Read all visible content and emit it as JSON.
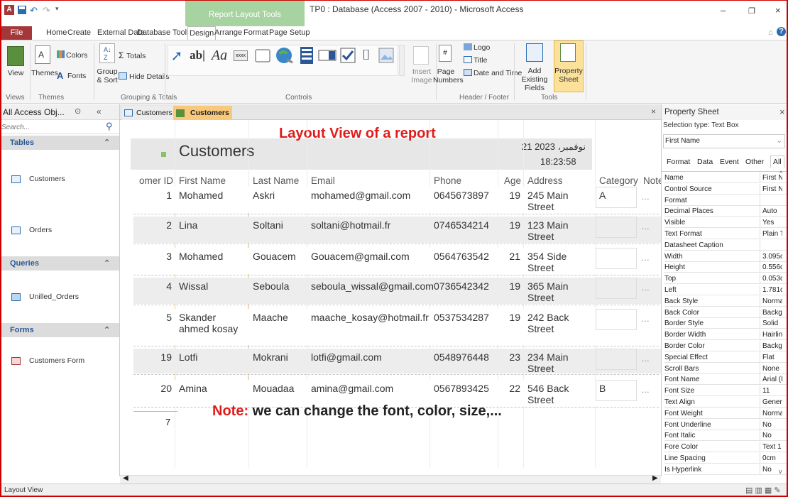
{
  "app": {
    "window_title": "TP0 : Database (Access 2007 - 2010) - Microsoft Access",
    "context_tab": "Report Layout Tools",
    "status_left": "Layout View"
  },
  "ribbon": {
    "tabs": [
      "File",
      "Home",
      "Create",
      "External Data",
      "Database Tools",
      "Design",
      "Arrange",
      "Format",
      "Page Setup"
    ],
    "active_tab": "Design",
    "views": {
      "view_label": "View",
      "group": "Views"
    },
    "themes": {
      "themes_label": "Themes",
      "colors_label": "Colors",
      "fonts_label": "Fonts",
      "group": "Themes"
    },
    "grouping": {
      "group_sort_label": "Group & Sort",
      "totals_label": "Totals",
      "hide_details_label": "Hide Details",
      "group": "Grouping & Totals"
    },
    "controls": {
      "group": "Controls",
      "textbox_glyph": "ab|",
      "label_glyph": "Aa",
      "button_glyph": "xxxx",
      "insert_image_label": "Insert Image"
    },
    "header_footer": {
      "page_numbers_label": "Page Numbers",
      "logo_label": "Logo",
      "title_label": "Title",
      "date_time_label": "Date and Time",
      "group": "Header / Footer"
    },
    "tools": {
      "add_existing_label": "Add Existing Fields",
      "property_sheet_label": "Property Sheet",
      "group": "Tools"
    }
  },
  "nav": {
    "title": "All Access Obj...",
    "search_placeholder": "Search...",
    "sections": [
      {
        "name": "Tables",
        "items": [
          "Customers",
          "Orders"
        ]
      },
      {
        "name": "Queries",
        "items": [
          "Unilled_Orders"
        ]
      },
      {
        "name": "Forms",
        "items": [
          "Customers Form"
        ]
      }
    ]
  },
  "doc_tabs": [
    "Customers",
    "Customers"
  ],
  "report": {
    "annotation": "Layout View of a report",
    "title": "Customers",
    "date": "21 نوفمبر، 2023",
    "time": "18:23:58",
    "columns": [
      "omer ID",
      "First Name",
      "Last Name",
      "Email",
      "Phone",
      "Age",
      "Address",
      "Category",
      "Note"
    ],
    "rows": [
      {
        "id": "1",
        "first": "Mohamed",
        "last": "Askri",
        "email": "mohamed@gmail.com",
        "phone": "0645673897",
        "age": "19",
        "address": "245 Main Street",
        "category": "A"
      },
      {
        "id": "2",
        "first": "Lina",
        "last": "Soltani",
        "email": "soltani@hotmail.fr",
        "phone": "0746534214",
        "age": "19",
        "address": "123 Main Street",
        "category": ""
      },
      {
        "id": "3",
        "first": "Mohamed",
        "last": "Gouacem",
        "email": "Gouacem@gmail.com",
        "phone": "0564763542",
        "age": "21",
        "address": "354 Side Street",
        "category": ""
      },
      {
        "id": "4",
        "first": "Wissal",
        "last": "Seboula",
        "email": "seboula_wissal@gmail.com",
        "phone": "0736542342",
        "age": "19",
        "address": "365 Main Street",
        "category": ""
      },
      {
        "id": "5",
        "first": "Skander ahmed kosay",
        "last": "Maache",
        "email": "maache_kosay@hotmail.fr",
        "phone": "0537534287",
        "age": "19",
        "address": "242 Back Street",
        "category": ""
      },
      {
        "id": "19",
        "first": "Lotfi",
        "last": "Mokrani",
        "email": "lotfi@gmail.com",
        "phone": "0548976448",
        "age": "23",
        "address": "234 Main Street",
        "category": ""
      },
      {
        "id": "20",
        "first": "Amina",
        "last": "Mouadaa",
        "email": "amina@gmail.com",
        "phone": "0567893425",
        "age": "22",
        "address": "546 Back Street",
        "category": "B"
      }
    ],
    "count": "7",
    "note_prefix": "Note:",
    "note_text": "we can change the font, color, size,..."
  },
  "property_sheet": {
    "title": "Property Sheet",
    "selection_type": "Selection type: Text Box",
    "selected": "First Name",
    "tabs": [
      "Format",
      "Data",
      "Event",
      "Other",
      "All"
    ],
    "rows": [
      {
        "name": "Name",
        "value": "First N"
      },
      {
        "name": "Control Source",
        "value": "First N"
      },
      {
        "name": "Format",
        "value": ""
      },
      {
        "name": "Decimal Places",
        "value": "Auto"
      },
      {
        "name": "Visible",
        "value": "Yes"
      },
      {
        "name": "Text Format",
        "value": "Plain T"
      },
      {
        "name": "Datasheet Caption",
        "value": ""
      },
      {
        "name": "Width",
        "value": "3.095c"
      },
      {
        "name": "Height",
        "value": "0.556c"
      },
      {
        "name": "Top",
        "value": "0.053c"
      },
      {
        "name": "Left",
        "value": "1.781c"
      },
      {
        "name": "Back Style",
        "value": "Norma"
      },
      {
        "name": "Back Color",
        "value": "Backgr"
      },
      {
        "name": "Border Style",
        "value": "Solid"
      },
      {
        "name": "Border Width",
        "value": "Hairlin"
      },
      {
        "name": "Border Color",
        "value": "Backgr"
      },
      {
        "name": "Special Effect",
        "value": "Flat"
      },
      {
        "name": "Scroll Bars",
        "value": "None"
      },
      {
        "name": "Font Name",
        "value": "Arial (I"
      },
      {
        "name": "Font Size",
        "value": "11"
      },
      {
        "name": "Text Align",
        "value": "Gener"
      },
      {
        "name": "Font Weight",
        "value": "Norma"
      },
      {
        "name": "Font Underline",
        "value": "No"
      },
      {
        "name": "Font Italic",
        "value": "No"
      },
      {
        "name": "Fore Color",
        "value": "Text 1"
      },
      {
        "name": "Line Spacing",
        "value": "0cm"
      },
      {
        "name": "Is Hyperlink",
        "value": "No"
      }
    ]
  },
  "colors": {
    "file_tab": "#a4373a",
    "context_band": "#a6d3a0",
    "annotation": "#e01b1b",
    "nav_section": "#2b5797",
    "active_doc_tab": "#f8c97b"
  }
}
